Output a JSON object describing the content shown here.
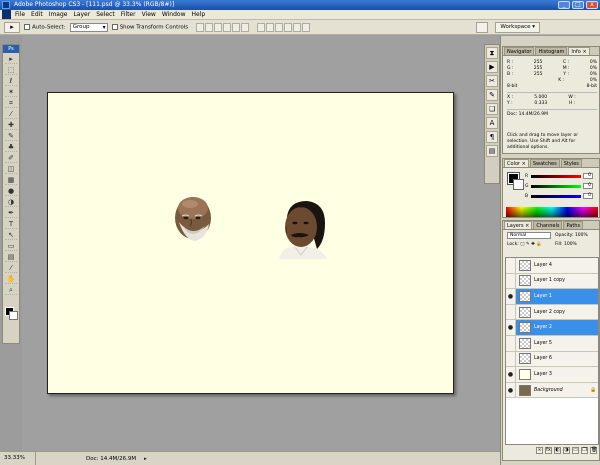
{
  "window": {
    "title": "Adobe Photoshop CS3 - [111.psd @ 33.3% (RGB/8#)]",
    "controls": [
      "_",
      "□",
      "x"
    ]
  },
  "menu": [
    "File",
    "Edit",
    "Image",
    "Layer",
    "Select",
    "Filter",
    "View",
    "Window",
    "Help"
  ],
  "options": {
    "auto_select_label": "Auto-Select:",
    "auto_select_value": "Group",
    "show_transform_label": "Show Transform Controls",
    "workspace_label": "Workspace ▾"
  },
  "toolbox": {
    "header": "Ps",
    "tools": [
      "move-icon",
      "marquee-icon",
      "lasso-icon",
      "magic-wand-icon",
      "crop-icon",
      "eyedropper-icon",
      "healing-icon",
      "brush-icon",
      "stamp-icon",
      "history-brush-icon",
      "eraser-icon",
      "gradient-icon",
      "blur-icon",
      "dodge-icon",
      "pen-icon",
      "type-icon",
      "path-select-icon",
      "shape-icon",
      "notes-icon",
      "eyedropper2-icon",
      "hand-icon",
      "zoom-icon"
    ],
    "glyphs": [
      "▸",
      "⬚",
      "ℓ",
      "✶",
      "⌗",
      "⁄",
      "✚",
      "✎",
      "♣",
      "✐",
      "◫",
      "▦",
      "●",
      "◑",
      "✒",
      "T",
      "↖",
      "▭",
      "▤",
      "⁄",
      "✋",
      "⌕"
    ],
    "foreground": "#000000",
    "background": "#ffffff"
  },
  "status": {
    "zoom": "33.33%",
    "doc": "Doc: 14.4M/26.9M"
  },
  "info_panel": {
    "tabs": [
      "Navigator",
      "Histogram",
      "Info ×"
    ],
    "rgb": [
      [
        "R :",
        "255"
      ],
      [
        "G :",
        "255"
      ],
      [
        "B :",
        "255"
      ]
    ],
    "cmyk": [
      [
        "C :",
        "0%"
      ],
      [
        "M :",
        "0%"
      ],
      [
        "Y :",
        "0%"
      ],
      [
        "K :",
        "0%"
      ]
    ],
    "bits_left": "8-bit",
    "bits_right": "8-bit",
    "xy": [
      [
        "X :",
        "5.000"
      ],
      [
        "Y :",
        "0.333"
      ]
    ],
    "wh": [
      [
        "W :",
        ""
      ],
      [
        "H :",
        ""
      ]
    ],
    "doc": "Doc: 14.4M/26.9M",
    "message": "Click and drag to move layer or selection. Use Shift and Alt for additional options."
  },
  "color_panel": {
    "tabs": [
      "Color ×",
      "Swatches",
      "Styles"
    ],
    "channels": [
      {
        "label": "R",
        "value": "0",
        "gradient": "linear-gradient(to right,#000,#f00)"
      },
      {
        "label": "G",
        "value": "0",
        "gradient": "linear-gradient(to right,#000,#0f0)"
      },
      {
        "label": "B",
        "value": "0",
        "gradient": "linear-gradient(to right,#000,#00f)"
      }
    ]
  },
  "layers_panel": {
    "tabs": [
      "Layers ×",
      "Channels",
      "Paths"
    ],
    "blend_mode": "Normal",
    "opacity_label": "Opacity:",
    "opacity_value": "100%",
    "lock_label": "Lock:",
    "fill_label": "Fill:",
    "fill_value": "100%",
    "layers": [
      {
        "name": "Layer 4",
        "visible": false,
        "selected": false,
        "thumb": "transparent"
      },
      {
        "name": "Layer 1 copy",
        "visible": false,
        "selected": false,
        "thumb": "transparent"
      },
      {
        "name": "Layer 1",
        "visible": true,
        "selected": true,
        "thumb": "transparent"
      },
      {
        "name": "Layer 2 copy",
        "visible": false,
        "selected": false,
        "thumb": "transparent"
      },
      {
        "name": "Layer 2",
        "visible": true,
        "selected": true,
        "thumb": "transparent"
      },
      {
        "name": "Layer 5",
        "visible": false,
        "selected": false,
        "thumb": "transparent"
      },
      {
        "name": "Layer 6",
        "visible": false,
        "selected": false,
        "thumb": "transparent"
      },
      {
        "name": "Layer 3",
        "visible": true,
        "selected": false,
        "thumb": "cream"
      },
      {
        "name": "Background",
        "visible": true,
        "selected": false,
        "thumb": "photo",
        "locked": true
      }
    ],
    "bottom_icons": [
      "link-icon",
      "fx-icon",
      "mask-icon",
      "adjustment-icon",
      "group-icon",
      "new-layer-icon",
      "trash-icon"
    ]
  },
  "canvas": {
    "background": "#ffffe3"
  }
}
